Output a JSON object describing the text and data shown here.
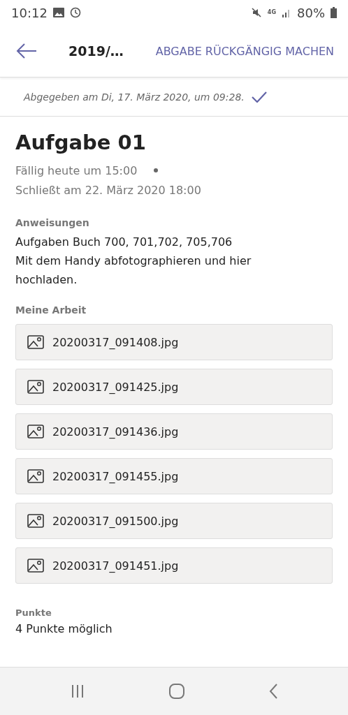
{
  "status_bar": {
    "time": "10:12",
    "network": "4G",
    "battery": "80%"
  },
  "header": {
    "title": "2019/…",
    "action": "ABGABE RÜCKGÄNGIG MACHEN"
  },
  "banner": {
    "text": "Abgegeben am Di, 17. März 2020, um 09:28.",
    "checked": true
  },
  "assignment": {
    "title": "Aufgabe 01",
    "due": "Fällig heute um 15:00",
    "closes": "Schließt am 22. März 2020 18:00"
  },
  "instructions": {
    "heading": "Anweisungen",
    "lines": [
      "Aufgaben Buch 700, 701,702, 705,706",
      "Mit dem Handy abfotographieren und hier hochladen."
    ]
  },
  "work": {
    "heading": "Meine Arbeit",
    "files": [
      {
        "name": "20200317_091408.jpg"
      },
      {
        "name": "20200317_091425.jpg"
      },
      {
        "name": "20200317_091436.jpg"
      },
      {
        "name": "20200317_091455.jpg"
      },
      {
        "name": "20200317_091500.jpg"
      },
      {
        "name": "20200317_091451.jpg"
      }
    ]
  },
  "points": {
    "heading": "Punkte",
    "text": "4 Punkte möglich"
  }
}
